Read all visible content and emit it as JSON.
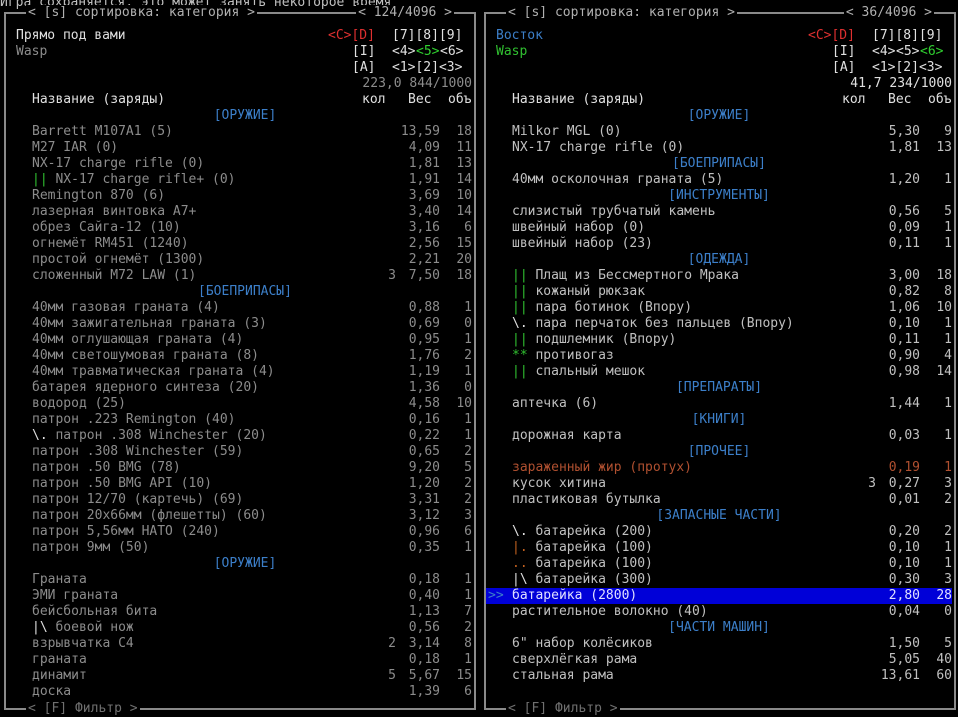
{
  "status_line": "Игра сохраняется, это может занять некоторое время",
  "left": {
    "header": "< [s] сортировка: категория >",
    "counter": "< 124/4096 >",
    "location": "Прямо под вами",
    "owner": "Wasp",
    "keys_row1": {
      "cd": "<C>[D]",
      "nums": "[7][8][9]"
    },
    "keys_row2": {
      "i": "[I]",
      "nums_a": "<4>",
      "nums_b": "<5>",
      "nums_c": "<6>"
    },
    "keys_row3": {
      "a": "[A]",
      "nums": "<1>[2]<3>"
    },
    "totals": "223,0 844/1000",
    "col_name": "Название (заряды)",
    "col_count": "кол",
    "col_weight": "Вес",
    "col_volume": "объ",
    "footer": "< [F] Фильтр >",
    "rows": [
      {
        "type": "cat",
        "text": "[ОРУЖИЕ]"
      },
      {
        "type": "item",
        "name": "Barrett M107A1 (5)",
        "count": "",
        "weight": "13,59",
        "vol": "18",
        "cls": "dim"
      },
      {
        "type": "item",
        "name": "M27 IAR (0)",
        "count": "",
        "weight": "4,09",
        "vol": "11",
        "cls": "dim"
      },
      {
        "type": "item",
        "name": "NX-17 charge rifle (0)",
        "count": "",
        "weight": "1,81",
        "vol": "13",
        "cls": "dim"
      },
      {
        "type": "item",
        "mark": "||",
        "name": " NX-17 charge rifle+ (0)",
        "count": "",
        "weight": "1,91",
        "vol": "14",
        "cls": "dim"
      },
      {
        "type": "item",
        "name": "Remington 870 (6)",
        "count": "",
        "weight": "3,69",
        "vol": "10",
        "cls": "dim"
      },
      {
        "type": "item",
        "name": "лазерная винтовка A7+",
        "count": "",
        "weight": "3,40",
        "vol": "14",
        "cls": "dim"
      },
      {
        "type": "item",
        "name": "обрез Сайга-12 (10)",
        "count": "",
        "weight": "3,16",
        "vol": "6",
        "cls": "dim"
      },
      {
        "type": "item",
        "name": "огнемёт RM451 (1240)",
        "count": "",
        "weight": "2,56",
        "vol": "15",
        "cls": "dim"
      },
      {
        "type": "item",
        "name": "простой огнемёт (1300)",
        "count": "",
        "weight": "2,21",
        "vol": "20",
        "cls": "dim"
      },
      {
        "type": "item",
        "name": "сложенный M72 LAW (1)",
        "count": "3",
        "weight": "7,50",
        "vol": "18",
        "cls": "dim"
      },
      {
        "type": "cat",
        "text": "[БОЕПРИПАСЫ]"
      },
      {
        "type": "item",
        "name": "40мм газовая граната (4)",
        "count": "",
        "weight": "0,88",
        "vol": "1",
        "cls": "dim"
      },
      {
        "type": "item",
        "name": "40мм зажигательная граната (3)",
        "count": "",
        "weight": "0,69",
        "vol": "0",
        "cls": "dim"
      },
      {
        "type": "item",
        "name": "40мм оглушающая граната (4)",
        "count": "",
        "weight": "0,95",
        "vol": "1",
        "cls": "dim"
      },
      {
        "type": "item",
        "name": "40мм светошумовая граната (8)",
        "count": "",
        "weight": "1,76",
        "vol": "2",
        "cls": "dim"
      },
      {
        "type": "item",
        "name": "40мм травматическая граната (4)",
        "count": "",
        "weight": "1,19",
        "vol": "1",
        "cls": "dim"
      },
      {
        "type": "item",
        "name": "батарея ядерного синтеза (20)",
        "count": "",
        "weight": "1,36",
        "vol": "0",
        "cls": "dim"
      },
      {
        "type": "item",
        "name": "водород (25)",
        "count": "",
        "weight": "4,58",
        "vol": "10",
        "cls": "dim"
      },
      {
        "type": "item",
        "name": "патрон .223 Remington (40)",
        "count": "",
        "weight": "0,16",
        "vol": "1",
        "cls": "dim"
      },
      {
        "type": "item",
        "mark": "\\.",
        "markcls": "white",
        "name": " патрон .308 Winchester (20)",
        "count": "",
        "weight": "0,22",
        "vol": "1",
        "cls": "dim"
      },
      {
        "type": "item",
        "name": "патрон .308 Winchester (59)",
        "count": "",
        "weight": "0,65",
        "vol": "2",
        "cls": "dim"
      },
      {
        "type": "item",
        "name": "патрон .50 BMG (78)",
        "count": "",
        "weight": "9,20",
        "vol": "5",
        "cls": "dim"
      },
      {
        "type": "item",
        "name": "патрон .50 BMG API (10)",
        "count": "",
        "weight": "1,20",
        "vol": "2",
        "cls": "dim"
      },
      {
        "type": "item",
        "name": "патрон 12/70 (картечь) (69)",
        "count": "",
        "weight": "3,31",
        "vol": "2",
        "cls": "dim"
      },
      {
        "type": "item",
        "name": "патрон 20x66мм (флешетты) (60)",
        "count": "",
        "weight": "3,12",
        "vol": "3",
        "cls": "dim"
      },
      {
        "type": "item",
        "name": "патрон 5,56мм НАТО (240)",
        "count": "",
        "weight": "0,96",
        "vol": "6",
        "cls": "dim"
      },
      {
        "type": "item",
        "name": "патрон 9мм (50)",
        "count": "",
        "weight": "0,35",
        "vol": "1",
        "cls": "dim"
      },
      {
        "type": "cat",
        "text": "[ОРУЖИЕ]"
      },
      {
        "type": "item",
        "name": "Граната",
        "count": "",
        "weight": "0,18",
        "vol": "1",
        "cls": "dim"
      },
      {
        "type": "item",
        "name": "ЭМИ граната",
        "count": "",
        "weight": "0,40",
        "vol": "1",
        "cls": "dim"
      },
      {
        "type": "item",
        "name": "бейсбольная бита",
        "count": "",
        "weight": "1,13",
        "vol": "7",
        "cls": "dim"
      },
      {
        "type": "item",
        "mark": "|\\",
        "markcls": "white",
        "name": " боевой нож",
        "count": "",
        "weight": "0,56",
        "vol": "2",
        "cls": "dim"
      },
      {
        "type": "item",
        "name": "взрывчатка C4",
        "count": "2",
        "weight": "3,14",
        "vol": "8",
        "cls": "dim"
      },
      {
        "type": "item",
        "name": "граната",
        "count": "",
        "weight": "0,18",
        "vol": "1",
        "cls": "dim"
      },
      {
        "type": "item",
        "name": "динамит",
        "count": "5",
        "weight": "5,67",
        "vol": "15",
        "cls": "dim"
      },
      {
        "type": "item",
        "name": "доска",
        "count": "",
        "weight": "1,39",
        "vol": "6",
        "cls": "dim"
      }
    ]
  },
  "right": {
    "header": "< [s] сортировка: категория >",
    "counter": "< 36/4096 >",
    "location": "Восток",
    "owner": "Wasp",
    "keys_row1": {
      "cd": "<C>[D]",
      "nums": "[7][8][9]"
    },
    "keys_row2": {
      "i": "[I]",
      "nums_a": "<4>",
      "nums_b": "<5>",
      "nums_c": "<6>"
    },
    "keys_row3": {
      "a": "[A]",
      "nums": "<1>[2]<3>"
    },
    "totals": "41,7 234/1000",
    "col_name": "Название (заряды)",
    "col_count": "кол",
    "col_weight": "Вес",
    "col_volume": "объ",
    "footer": "< [F] Фильтр >",
    "rows": [
      {
        "type": "cat",
        "text": "[ОРУЖИЕ]"
      },
      {
        "type": "item",
        "name": "Milkor MGL (0)",
        "count": "",
        "weight": "5,30",
        "vol": "9",
        "cls": ""
      },
      {
        "type": "item",
        "name": "NX-17 charge rifle (0)",
        "count": "",
        "weight": "1,81",
        "vol": "13",
        "cls": ""
      },
      {
        "type": "cat",
        "text": "[БОЕПРИПАСЫ]"
      },
      {
        "type": "item",
        "name": "40мм осколочная граната (5)",
        "count": "",
        "weight": "1,20",
        "vol": "1",
        "cls": ""
      },
      {
        "type": "cat",
        "text": "[ИНСТРУМЕНТЫ]"
      },
      {
        "type": "item",
        "name": "слизистый трубчатый камень",
        "count": "",
        "weight": "0,56",
        "vol": "5",
        "cls": ""
      },
      {
        "type": "item",
        "name": "швейный набор (0)",
        "count": "",
        "weight": "0,09",
        "vol": "1",
        "cls": ""
      },
      {
        "type": "item",
        "name": "швейный набор (23)",
        "count": "",
        "weight": "0,11",
        "vol": "1",
        "cls": ""
      },
      {
        "type": "cat",
        "text": "[ОДЕЖДА]"
      },
      {
        "type": "item",
        "mark": "||",
        "name": " Плащ из Бессмертного Мрака",
        "count": "",
        "weight": "3,00",
        "vol": "18",
        "cls": ""
      },
      {
        "type": "item",
        "mark": "||",
        "name": " кожаный рюкзак",
        "count": "",
        "weight": "0,82",
        "vol": "8",
        "cls": ""
      },
      {
        "type": "item",
        "mark": "||",
        "name": " пара ботинок (Впору)",
        "count": "",
        "weight": "1,06",
        "vol": "10",
        "cls": ""
      },
      {
        "type": "item",
        "mark": "\\.",
        "markcls": "white",
        "name": " пара перчаток без пальцев (Впору)",
        "count": "",
        "weight": "0,10",
        "vol": "1",
        "cls": ""
      },
      {
        "type": "item",
        "mark": "||",
        "name": " подшлемник (Впору)",
        "count": "",
        "weight": "0,11",
        "vol": "1",
        "cls": ""
      },
      {
        "type": "item",
        "mark": "**",
        "name": " противогаз",
        "count": "",
        "weight": "0,90",
        "vol": "4",
        "cls": ""
      },
      {
        "type": "item",
        "mark": "||",
        "name": " спальный мешок",
        "count": "",
        "weight": "0,98",
        "vol": "14",
        "cls": ""
      },
      {
        "type": "cat",
        "text": "[ПРЕПАРАТЫ]"
      },
      {
        "type": "item",
        "name": "аптечка (6)",
        "count": "",
        "weight": "1,44",
        "vol": "1",
        "cls": ""
      },
      {
        "type": "cat",
        "text": "[КНИГИ]"
      },
      {
        "type": "item",
        "name": "дорожная карта",
        "count": "",
        "weight": "0,03",
        "vol": "1",
        "cls": ""
      },
      {
        "type": "cat",
        "text": "[ПРОЧЕЕ]"
      },
      {
        "type": "item",
        "name": "зараженный жир (протух)",
        "count": "",
        "weight": "0,19",
        "vol": "1",
        "cls": "brown"
      },
      {
        "type": "item",
        "name": "кусок хитина",
        "count": "3",
        "weight": "0,27",
        "vol": "3",
        "cls": ""
      },
      {
        "type": "item",
        "name": "пластиковая бутылка",
        "count": "",
        "weight": "0,01",
        "vol": "2",
        "cls": ""
      },
      {
        "type": "cat",
        "text": "[ЗАПАСНЫЕ ЧАСТИ]"
      },
      {
        "type": "item",
        "mark": "\\.",
        "markcls": "white",
        "name": " батарейка (200)",
        "count": "",
        "weight": "0,20",
        "vol": "2",
        "cls": ""
      },
      {
        "type": "item",
        "mark": "|.",
        "markcls": "mark-orange",
        "name": " батарейка (100)",
        "count": "",
        "weight": "0,10",
        "vol": "1",
        "cls": ""
      },
      {
        "type": "item",
        "mark": "..",
        "markcls": "mark-orange",
        "name": " батарейка (100)",
        "count": "",
        "weight": "0,10",
        "vol": "1",
        "cls": ""
      },
      {
        "type": "item",
        "mark": "|\\",
        "markcls": "white",
        "name": " батарейка (300)",
        "count": "",
        "weight": "0,30",
        "vol": "3",
        "cls": ""
      },
      {
        "type": "item",
        "name": "батарейка (2800)",
        "count": "",
        "weight": "2,80",
        "vol": "28",
        "cls": "",
        "selected": true,
        "cursor": ">>"
      },
      {
        "type": "item",
        "name": "растительное волокно (40)",
        "count": "",
        "weight": "0,04",
        "vol": "0",
        "cls": ""
      },
      {
        "type": "cat",
        "text": "[ЧАСТИ МАШИН]"
      },
      {
        "type": "item",
        "name": "6\" набор колёсиков",
        "count": "",
        "weight": "1,50",
        "vol": "5",
        "cls": ""
      },
      {
        "type": "item",
        "name": "сверхлёгкая рама",
        "count": "",
        "weight": "5,05",
        "vol": "40",
        "cls": ""
      },
      {
        "type": "item",
        "name": "стальная рама",
        "count": "",
        "weight": "13,61",
        "vol": "60",
        "cls": ""
      }
    ]
  }
}
